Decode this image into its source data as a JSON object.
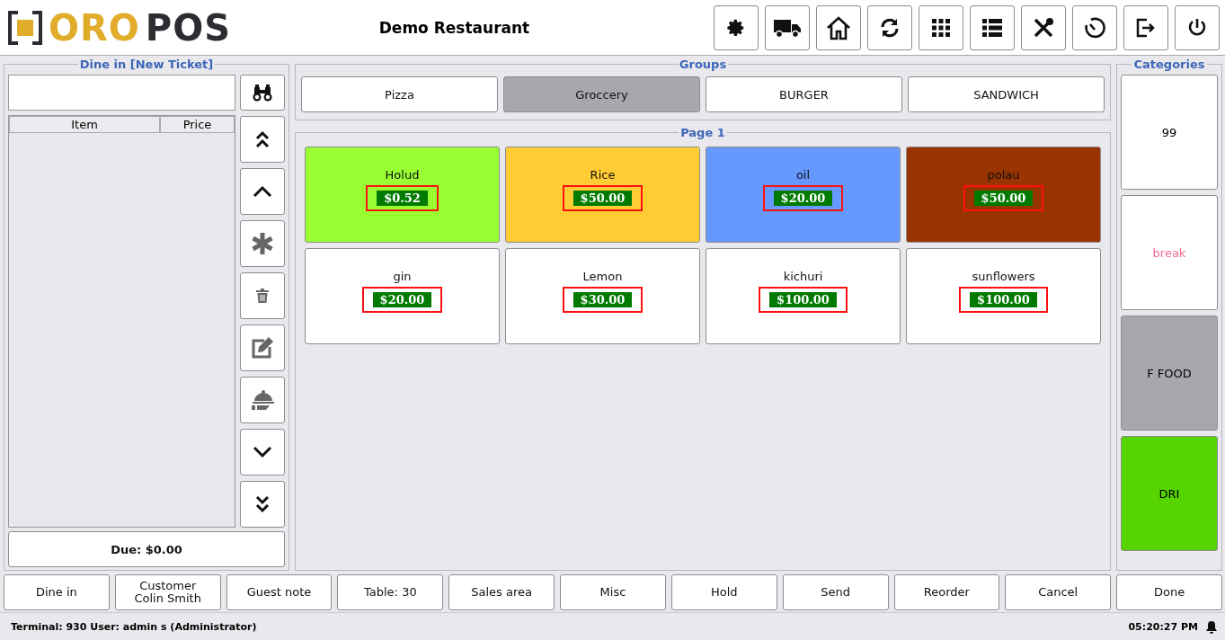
{
  "logo": {
    "part_1": "ORO",
    "part_2": "POS"
  },
  "header": {
    "title": "Demo Restaurant"
  },
  "ticket": {
    "title": "Dine in [New Ticket]",
    "columns": [
      "Item",
      "Price"
    ],
    "due": "Due: $0.00"
  },
  "groups": {
    "title": "Groups",
    "items": [
      {
        "label": "Pizza",
        "selected": false
      },
      {
        "label": "Groccery",
        "selected": true
      },
      {
        "label": "BURGER",
        "selected": false
      },
      {
        "label": "SANDWICH",
        "selected": false
      }
    ]
  },
  "page": {
    "title": "Page 1",
    "items": [
      {
        "name": "Holud",
        "price": "$0.52",
        "color": "#99ff33"
      },
      {
        "name": "Rice",
        "price": "$50.00",
        "color": "#ffcc33"
      },
      {
        "name": "oil",
        "price": "$20.00",
        "color": "#6699ff"
      },
      {
        "name": "polau",
        "price": "$50.00",
        "color": "#993300"
      },
      {
        "name": "gin",
        "price": "$20.00",
        "color": "#ffffff"
      },
      {
        "name": "Lemon",
        "price": "$30.00",
        "color": "#ffffff"
      },
      {
        "name": "kichuri",
        "price": "$100.00",
        "color": "#ffffff"
      },
      {
        "name": "sunflowers",
        "price": "$100.00",
        "color": "#ffffff"
      }
    ]
  },
  "categories": {
    "title": "Categories",
    "items": [
      {
        "label": "99",
        "color": "#ffffff",
        "kind": "plain"
      },
      {
        "label": "break",
        "color": "#ffffff",
        "kind": "accent"
      },
      {
        "label": "F FOOD",
        "color": "#a8a7ac",
        "kind": "plain"
      },
      {
        "label": "DRI",
        "color": "#55d400",
        "kind": "plain"
      }
    ]
  },
  "actions": [
    {
      "lines": [
        "Dine in"
      ]
    },
    {
      "lines": [
        "Customer",
        "Colin Smith"
      ]
    },
    {
      "lines": [
        "Guest note"
      ]
    },
    {
      "lines": [
        "Table: 30"
      ]
    },
    {
      "lines": [
        "Sales area"
      ]
    },
    {
      "lines": [
        "Misc"
      ]
    },
    {
      "lines": [
        "Hold"
      ]
    },
    {
      "lines": [
        "Send"
      ]
    },
    {
      "lines": [
        "Reorder"
      ]
    },
    {
      "lines": [
        "Cancel"
      ]
    },
    {
      "lines": [
        "Done"
      ]
    }
  ],
  "status_bar": {
    "info": "Terminal: 930 User: admin s (Administrator)",
    "time": "05:20:27 PM"
  }
}
